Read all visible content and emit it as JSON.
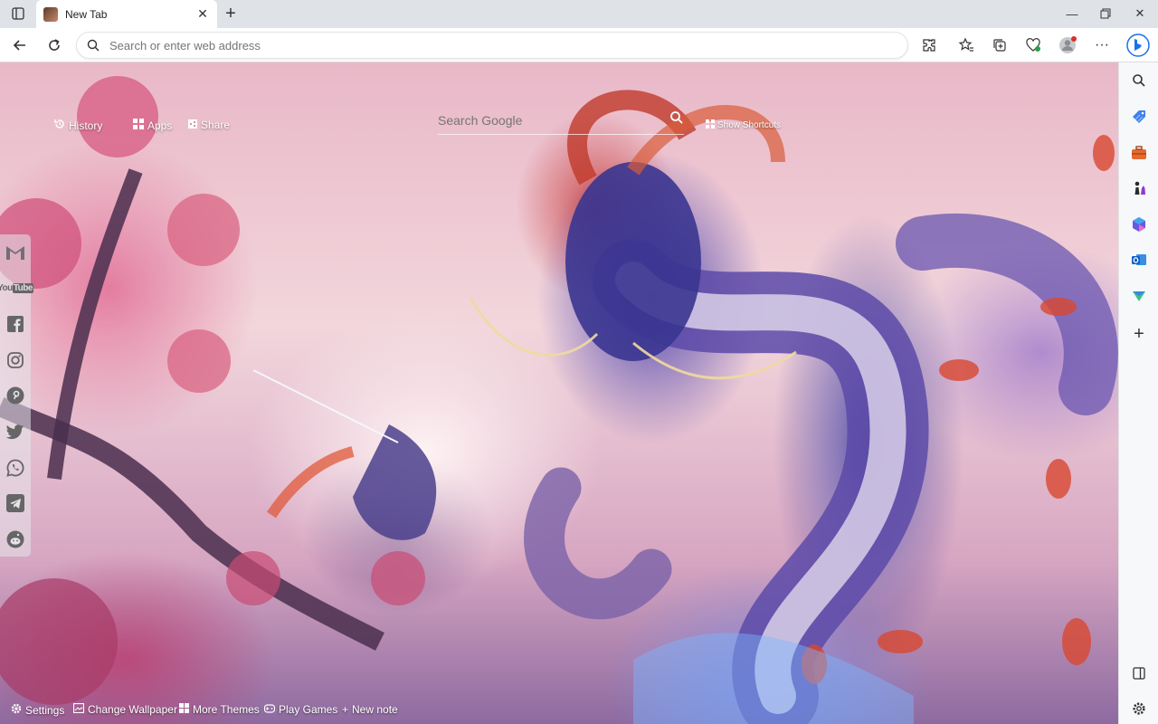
{
  "browser": {
    "tab_title": "New Tab",
    "address_placeholder": "Search or enter web address"
  },
  "ntp": {
    "history_label": "History",
    "apps_label": "Apps",
    "share_label": "Share",
    "search_placeholder": "Search Google",
    "show_shortcuts_label": "Show Shortcuts"
  },
  "social_links": [
    "gmail-icon",
    "youtube-icon",
    "facebook-icon",
    "instagram-icon",
    "pinterest-icon",
    "twitter-icon",
    "whatsapp-icon",
    "telegram-icon",
    "reddit-icon"
  ],
  "bottom_bar": {
    "settings": "Settings",
    "change_wallpaper": "Change Wallpaper",
    "more_themes": "More Themes",
    "play_games": "Play Games",
    "new_note": "New note"
  },
  "colors": {
    "tab_strip": "#dfe3e8",
    "toolbar": "#ffffff",
    "sidebar": "#f7f8fa",
    "edge_blue": "#1a73e8"
  }
}
